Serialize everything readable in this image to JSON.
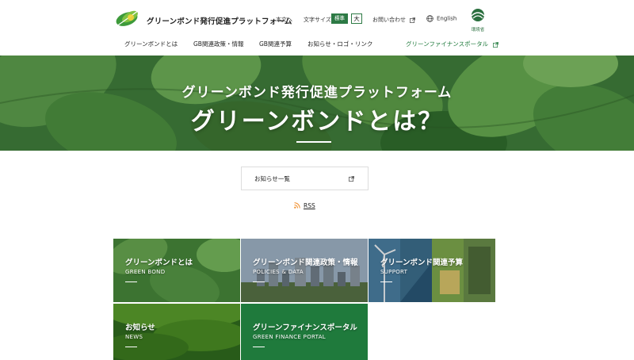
{
  "header": {
    "site_title": "グリーンボンド発行促進プラットフォーム",
    "skip_link": "本文へ",
    "font_size_label": "文字サイズ",
    "font_size_standard": "標準",
    "font_size_large": "大",
    "contact": "お問い合わせ",
    "language": "English",
    "ministry": "環境省"
  },
  "nav": {
    "items": [
      {
        "label": "グリーンボンドとは"
      },
      {
        "label": "GB関連政策・情報"
      },
      {
        "label": "GB関連予算"
      },
      {
        "label": "お知らせ・ロゴ・リンク"
      }
    ],
    "portal": "グリーンファイナンスポータル"
  },
  "hero": {
    "subtitle": "グリーンボンド発行促進プラットフォーム",
    "title": "グリーンボンドとは？"
  },
  "news": {
    "list_label": "お知らせ一覧",
    "rss": "RSS"
  },
  "tiles": [
    {
      "jp": "グリーンボンドとは",
      "en": "GREEN BOND"
    },
    {
      "jp": "グリーンボンド関連政策・情報",
      "en": "POLICIES & DATA"
    },
    {
      "jp": "グリーンボンド関連予算",
      "en": "SUPPORT"
    },
    {
      "jp": "お知らせ",
      "en": "NEWS"
    },
    {
      "jp": "グリーンファイナンスポータル",
      "en": "GREEN FINANCE PORTAL"
    }
  ],
  "colors": {
    "brand_green": "#2d7a45",
    "portal_tile": "#1f7a3c",
    "portal_link": "#1f7a3c"
  }
}
